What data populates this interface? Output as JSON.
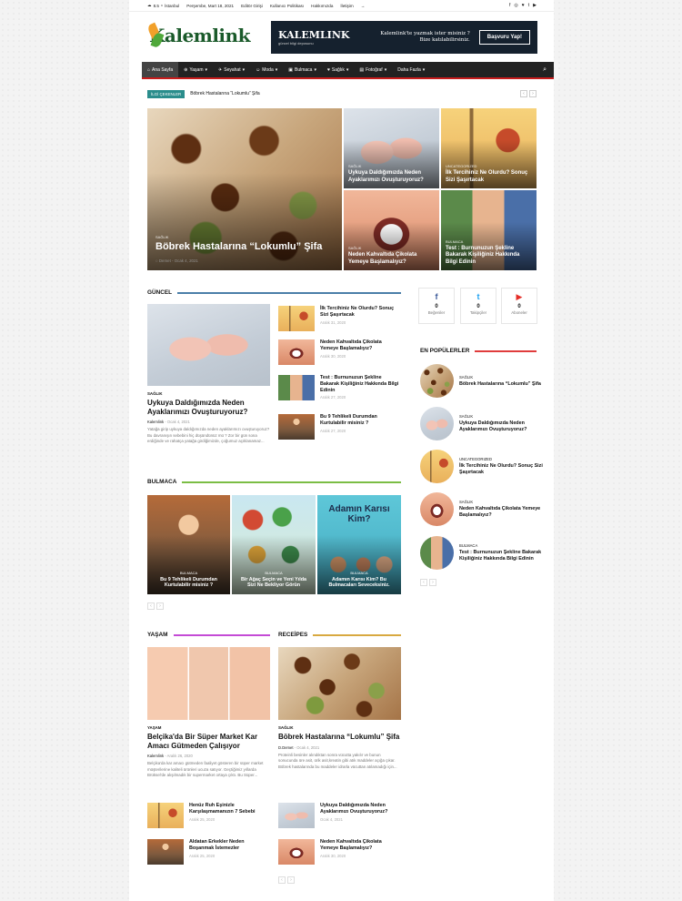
{
  "topbar": {
    "temp": "8.5",
    "temp_unit": "C",
    "city": "İstanbul",
    "date": "Perşembe, Mart 18, 2021",
    "links": [
      "Editör Girişi",
      "Kullanıcı Politikası",
      "Hakkımızda",
      "İletişim"
    ],
    "login_icon": "→",
    "socials": [
      "f",
      "◎",
      "♥",
      "t",
      "▶"
    ]
  },
  "logo": {
    "text": "Kalemlink"
  },
  "ad": {
    "logo": "KALEMLINK",
    "sub": "güncel bilgi deposunu",
    "line1": "Kalemlink'te yazmak ister misiniz ?",
    "line2": "Bize katılabilirsiniz.",
    "button": "Başvuru Yap!"
  },
  "nav": {
    "items": [
      {
        "label": "Ana Sayfa",
        "icon": "⌂"
      },
      {
        "label": "Yaşam",
        "icon": "⊕"
      },
      {
        "label": "Seyahat",
        "icon": "✈"
      },
      {
        "label": "Moda",
        "icon": "☺"
      },
      {
        "label": "Bulmaca",
        "icon": "▣"
      },
      {
        "label": "Sağlık",
        "icon": "♥"
      },
      {
        "label": "Fotoğraf",
        "icon": "▤"
      },
      {
        "label": "Daha Fazla",
        "icon": ""
      }
    ],
    "search_icon": "⌕"
  },
  "trending": {
    "label": "İLGİ ÇEKENLER",
    "headline": "Böbrek Hastalarına “Lokumlu” Şifa"
  },
  "hero": {
    "main": {
      "category": "SAĞLIK",
      "title": "Böbrek Hastalarına “Lokumlu” Şifa",
      "author": "Demet",
      "date": "Ocak 4, 2021"
    },
    "tiles": [
      {
        "category": "SAĞLIK",
        "title": "Uykuya Daldığımızda Neden Ayaklarımızı Ovuşturuyoruz?"
      },
      {
        "category": "UNCATEGORIZED",
        "title": "İlk Tercihiniz Ne Olurdu? Sonuç Sizi Şaşırtacak"
      },
      {
        "category": "SAĞLIK",
        "title": "Neden Kahvaltıda Çikolata Yemeye Başlamalıyız?"
      },
      {
        "category": "BULMACA",
        "title": "Test : Burnunuzun Şekline Bakarak Kişiliğiniz Hakkında Bilgi Edinin"
      }
    ]
  },
  "guncel": {
    "title": "GÜNCEL",
    "main": {
      "category": "SAĞLIK",
      "title": "Uykuya Daldığımızda Neden Ayaklarımızı Ovuşturuyoruz?",
      "author": "Kalemlink",
      "date": "Ocak 4, 2021",
      "excerpt": "Yatağa girip uykuya daldığımızda neden ayaklarımızı ovuşturuyoruz? Bu davranışın sebebini hiç düşündünüz mü ? Zor bir gün sona erdiğinde ve rahatça yatağa girdiğimizde, çoğumuz açıklanamaz..."
    },
    "list": [
      {
        "title": "İlk Tercihiniz Ne Olurdu? Sonuç Sizi Şaşırtacak",
        "date": "Aralık 31, 2020"
      },
      {
        "title": "Neden Kahvaltıda Çikolata Yemeye Başlamalıyız?",
        "date": "Aralık 30, 2020"
      },
      {
        "title": "Test : Burnunuzun Şekline Bakarak Kişiliğiniz Hakkında Bilgi Edinin",
        "date": "Aralık 27, 2020"
      },
      {
        "title": "Bu 9 Tehlikeli Durumdan Kurtulabilir misiniz ?",
        "date": "Aralık 27, 2020"
      }
    ]
  },
  "social": [
    {
      "icon": "f",
      "count": "0",
      "label": "Beğeniler",
      "color": "#3b5998"
    },
    {
      "icon": "t",
      "count": "0",
      "label": "Takipçiler",
      "color": "#1da1f2"
    },
    {
      "icon": "▶",
      "count": "0",
      "label": "Aboneler",
      "color": "#e52d27"
    }
  ],
  "popular": {
    "title": "EN POPÜLERLER",
    "items": [
      {
        "category": "SAĞLIK",
        "title": "Böbrek Hastalarına “Lokumlu” Şifa"
      },
      {
        "category": "SAĞLIK",
        "title": "Uykuya Daldığımızda Neden Ayaklarımızı Ovuşturuyoruz?"
      },
      {
        "category": "UNCATEGORIZED",
        "title": "İlk Tercihiniz Ne Olurdu? Sonuç Sizi Şaşırtacak"
      },
      {
        "category": "SAĞLIK",
        "title": "Neden Kahvaltıda Çikolata Yemeye Başlamalıyız?"
      },
      {
        "category": "BULMACA",
        "title": "Test : Burnunuzun Şekline Bakarak Kişiliğiniz Hakkında Bilgi Edinin"
      }
    ]
  },
  "bulmaca": {
    "title": "BULMACA",
    "cards": [
      {
        "category": "BULMACA",
        "title": "Bu 9 Tehlikeli Durumdan Kurtulabilir misiniz ?"
      },
      {
        "category": "BULMACA",
        "title": "Bir Ağaç Seçin ve Yeni Yılda Sizi Ne Bekliyor Görün"
      },
      {
        "category": "BULMACA",
        "title": "Adamın Karısı Kim? Bu Bulmacaları Seveceksiniz."
      }
    ],
    "card3_overlay": "Adamın Karısı Kim?"
  },
  "yasam": {
    "title": "YAŞAM",
    "main": {
      "category": "YAŞAM",
      "title": "Belçika'da Bir Süper Market Kar Amacı Gütmeden Çalışıyor",
      "author": "Kalemlink",
      "date": "Aralık 26, 2020",
      "excerpt": "Belçika'da kar amacı gütmeden faaliyet gösteren bir süper market müşterilerine kaliteli ürünleri ucuza satıyor. Geçtiğimiz yıllarda Brüksel'de alışılmadık bir supermarket ortaya çıktı. Bu Süper..."
    },
    "list": [
      {
        "title": "Henüz Ruh Eşinizle Karşılaşmamanızın 7 Sebebi",
        "date": "Aralık 25, 2020"
      },
      {
        "title": "Aldatan Erkekler Neden Boşanmak İstemezler",
        "date": "Aralık 25, 2020"
      }
    ]
  },
  "receipes": {
    "title": "RECEİPES",
    "main": {
      "category": "SAĞLIK",
      "title": "Böbrek Hastalarına “Lokumlu” Şifa",
      "author": "D.Demet",
      "date": "Ocak 4, 2021",
      "excerpt": "Proteinli besinler alındıktan sonra vücutta yakılır ve bunun sonucunda üre asit, ürik asit,kreatin gibi atık maddeler açığa çıkar. Böbrek hastalarında bu maddeler idrarla vücuttan atılamadığı için..."
    },
    "list": [
      {
        "title": "Uykuya Daldığımızda Neden Ayaklarımızı Ovuşturuyoruz?",
        "date": "Ocak 4, 2021"
      },
      {
        "title": "Neden Kahvaltıda Çikolata Yemeye Başlamalıyız?",
        "date": "Aralık 30, 2020"
      }
    ]
  },
  "colors": {
    "nav_bg": "#222222",
    "accent_red": "#c91c1c",
    "trend_label": "#2a8d8c",
    "guncel_line": "#4a7ea8",
    "bulmaca_line": "#7bbd45",
    "yasam_line": "#c44bd6",
    "receipes_line": "#d8a940",
    "popular_line": "#e03c3c"
  }
}
